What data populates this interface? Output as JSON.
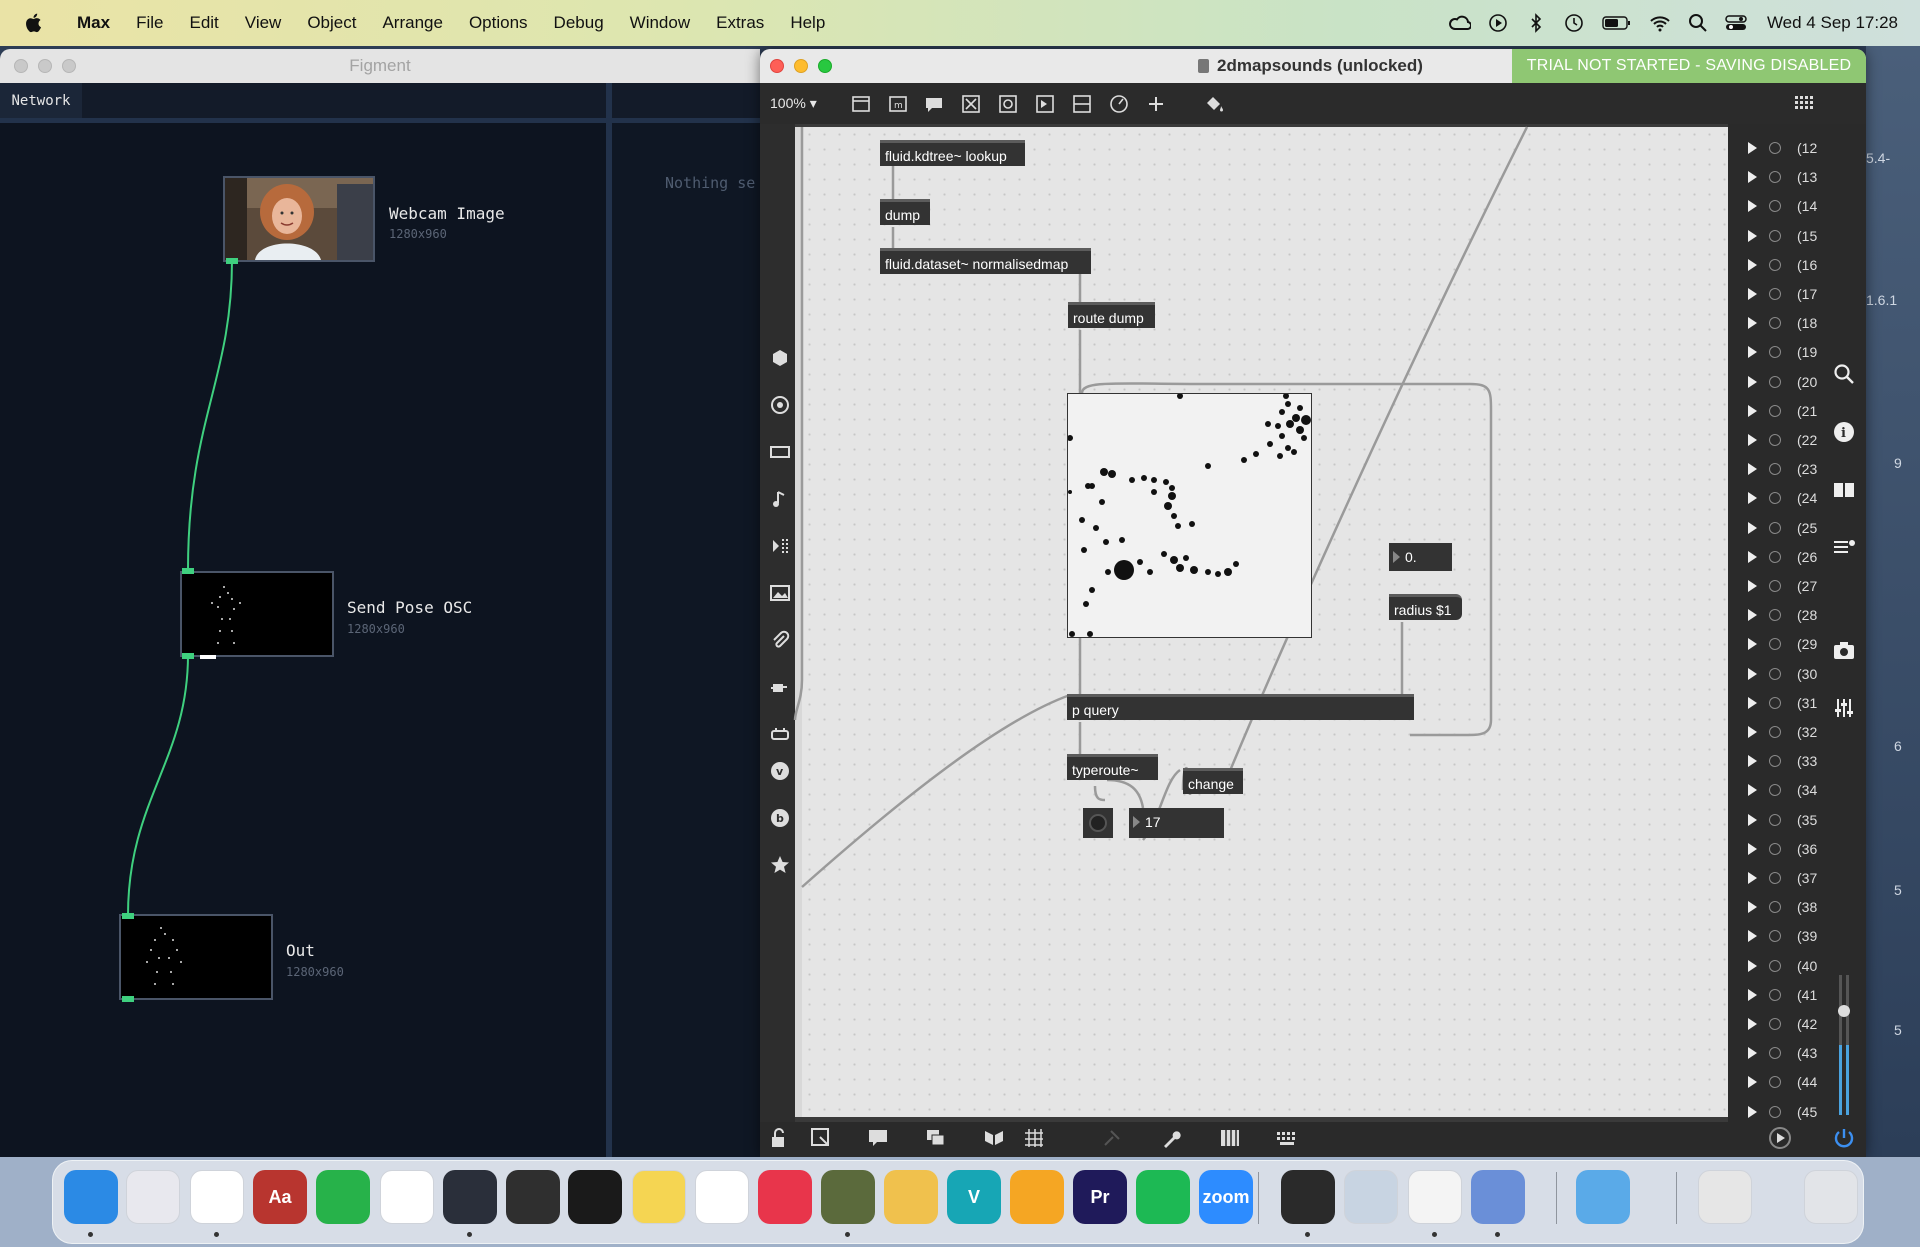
{
  "menubar": {
    "app_name": "Max",
    "items": [
      "File",
      "Edit",
      "View",
      "Object",
      "Arrange",
      "Options",
      "Debug",
      "Window",
      "Extras",
      "Help"
    ],
    "clock": "Wed 4 Sep  17:28",
    "status_icons": [
      "creative-cloud-icon",
      "play-circle-icon",
      "bluetooth-icon",
      "time-machine-icon",
      "battery-icon",
      "wifi-icon",
      "spotlight-search-icon",
      "control-center-icon"
    ]
  },
  "figment": {
    "title": "Figment",
    "tab": "Network",
    "empty_panel_text": "Nothing se",
    "nodes": [
      {
        "title": "Webcam Image",
        "size": "1280x960"
      },
      {
        "title": "Send Pose OSC",
        "size": "1280x960"
      },
      {
        "title": "Out",
        "size": "1280x960"
      }
    ]
  },
  "max": {
    "window_title": "2dmapsounds (unlocked)",
    "trial_banner": "TRIAL NOT STARTED - SAVING DISABLED",
    "zoom": "100%",
    "objects": {
      "kdtree": "fluid.kdtree~ lookup",
      "dump": "dump",
      "dataset": "fluid.dataset~ normalisedmap",
      "route": "route dump",
      "pquery": "p query",
      "typeroute": "typeroute~",
      "change": "change",
      "radius": "radius $1"
    },
    "numbers": {
      "float_box": "0.",
      "int_box": "17"
    },
    "message_labels": [
      "(12",
      "(13",
      "(14",
      "(15",
      "(16",
      "(17",
      "(18",
      "(19",
      "(20",
      "(21",
      "(22",
      "(23",
      "(24",
      "(25",
      "(26",
      "(27",
      "(28",
      "(29",
      "(30",
      "(31",
      "(32",
      "(33",
      "(34",
      "(35",
      "(36",
      "(37",
      "(38",
      "(39",
      "(40",
      "(41",
      "(42",
      "(43",
      "(44",
      "(45"
    ],
    "desktop_fragments": [
      "5.4-",
      "1.6.1",
      "9",
      "6",
      "5",
      "5"
    ]
  },
  "dock": {
    "apps": [
      {
        "name": "finder",
        "label": "",
        "color": "#2b8ae5"
      },
      {
        "name": "launchpad",
        "label": "",
        "color": "#e8e8ee"
      },
      {
        "name": "chrome",
        "label": "",
        "color": "#ffffff"
      },
      {
        "name": "dictionary",
        "label": "Aa",
        "color": "#b8352f"
      },
      {
        "name": "numbers",
        "label": "",
        "color": "#27b24a"
      },
      {
        "name": "slack",
        "label": "",
        "color": "#ffffff"
      },
      {
        "name": "quicktime",
        "label": "",
        "color": "#2a2f3a"
      },
      {
        "name": "garageband",
        "label": "",
        "color": "#2f2f2f"
      },
      {
        "name": "unity",
        "label": "",
        "color": "#1a1a1a"
      },
      {
        "name": "notes",
        "label": "",
        "color": "#f5d552"
      },
      {
        "name": "freeform",
        "label": "",
        "color": "#ffffff"
      },
      {
        "name": "creative-cloud",
        "label": "",
        "color": "#e8354b"
      },
      {
        "name": "max",
        "label": "",
        "color": "#5b6a3c"
      },
      {
        "name": "cocktail",
        "label": "",
        "color": "#f0c14d"
      },
      {
        "name": "vectorworks",
        "label": "V",
        "color": "#17a6b5"
      },
      {
        "name": "pages",
        "label": "",
        "color": "#f5a623"
      },
      {
        "name": "premiere",
        "label": "Pr",
        "color": "#1f1a5a"
      },
      {
        "name": "spotify",
        "label": "",
        "color": "#1db954"
      },
      {
        "name": "zoom",
        "label": "zoom",
        "color": "#2d8cff"
      },
      {
        "name": "figment",
        "label": "",
        "color": "#2a2a2a"
      },
      {
        "name": "preview",
        "label": "",
        "color": "#c8d4e2"
      },
      {
        "name": "textedit",
        "label": "",
        "color": "#f4f4f4"
      },
      {
        "name": "testflight",
        "label": "",
        "color": "#6a8fd8"
      },
      {
        "name": "downloads-folder",
        "label": "",
        "color": "#5aaae8"
      },
      {
        "name": "recent-window",
        "label": "",
        "color": "#e6e6e6"
      },
      {
        "name": "trash",
        "label": "",
        "color": "#e2e4e8"
      }
    ]
  },
  "colors": {
    "figment_bg": "#0d1420",
    "wire_green": "#3fd07f",
    "trial_green": "#8fc773",
    "max_object": "#333333",
    "patcher_bg": "#e5e5e5"
  }
}
